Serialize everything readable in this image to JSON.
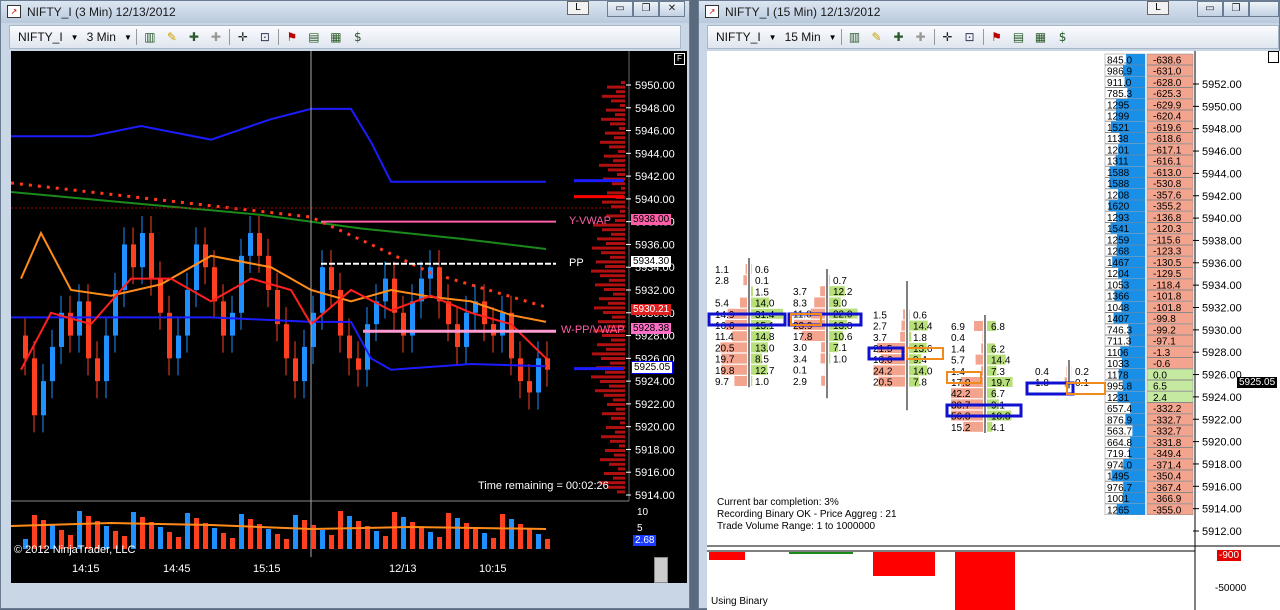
{
  "left_window": {
    "title": "NIFTY_I (3 Min)  12/13/2012",
    "toolbar": {
      "instrument": "NIFTY_I",
      "period": "3 Min"
    },
    "buttons": {
      "link": "L",
      "minimize": "▭",
      "restore": "❐",
      "close": "✕"
    },
    "chart": {
      "f_button": "F",
      "price_ticks": [
        "5950.00",
        "5948.00",
        "5946.00",
        "5944.00",
        "5942.00",
        "5940.00",
        "5938.00",
        "5936.00",
        "5934.00",
        "5932.00",
        "5930.00",
        "5928.00",
        "5926.00",
        "5924.00",
        "5922.00",
        "5920.00",
        "5918.00",
        "5916.00",
        "5914.00"
      ],
      "labels": {
        "y_vwap": "Y-VWAP",
        "pp": "PP",
        "wapp_vwap": "W-PP/VWAP"
      },
      "price_badges": {
        "y_vwap": "5938.00",
        "pp": "5934.30",
        "red": "5930.21",
        "pink": "5928.38",
        "current": "5925.05"
      },
      "time_remaining": "Time remaining = 00:02:26",
      "copyright": "© 2012 NinjaTrader, LLC",
      "volume_ticks": [
        "10",
        "5"
      ],
      "volume_badge": "2.68",
      "x_ticks": [
        "14:15",
        "14:45",
        "15:15",
        "12/13",
        "10:15"
      ]
    }
  },
  "right_window": {
    "title": "NIFTY_I (15 Min)  12/13/2012",
    "toolbar": {
      "instrument": "NIFTY_I",
      "period": "15 Min"
    },
    "buttons": {
      "link": "L",
      "minimize": "▭",
      "restore": "❐"
    },
    "chart": {
      "price_ticks": [
        "5952.00",
        "5950.00",
        "5948.00",
        "5946.00",
        "5944.00",
        "5942.00",
        "5940.00",
        "5938.00",
        "5936.00",
        "5934.00",
        "5932.00",
        "5930.00",
        "5928.00",
        "5926.00",
        "5924.00",
        "5922.00",
        "5920.00",
        "5918.00",
        "5916.00",
        "5914.00",
        "5912.00"
      ],
      "current_price": "5925.05",
      "status_lines": [
        "Current bar completion: 3%",
        "Recording Binary OK - Price Aggreg : 21",
        "Trade Volume Range: 1 to 1000000"
      ],
      "using_binary": "Using Binary",
      "copyright": "© 2012 NinjaTrader, LLC",
      "lower_ticks": [
        "-900",
        "-50000"
      ],
      "ladder_volume": [
        "845.0",
        "986.9",
        "911.0",
        "785.3",
        "1295",
        "1299",
        "1521",
        "1138",
        "1201",
        "1311",
        "1588",
        "1588",
        "1208",
        "1620",
        "1293",
        "1541",
        "1259",
        "1268",
        "1467",
        "1204",
        "1053",
        "1366",
        "1048",
        "1407",
        "746.3",
        "711.3",
        "1106",
        "1033",
        "1178",
        "995.8",
        "1231",
        "657.4",
        "876.9",
        "563.7",
        "664.8",
        "719.1",
        "974.0",
        "1495",
        "976.7",
        "1001",
        "1265"
      ],
      "ladder_delta": [
        "-638.6",
        "-631.0",
        "-628.0",
        "-625.3",
        "-629.9",
        "-620.4",
        "-619.6",
        "-618.6",
        "-617.1",
        "-616.1",
        "-613.0",
        "-530.8",
        "-357.6",
        "-355.2",
        "-136.8",
        "-120.3",
        "-115.6",
        "-123.3",
        "-130.5",
        "-129.5",
        "-118.4",
        "-101.8",
        "-101.8",
        "-99.8",
        "-99.2",
        "-97.1",
        "-1.3",
        "-0.6",
        "0.0",
        "6.5",
        "2.4",
        "-332.2",
        "-332.7",
        "-332.7",
        "-331.8",
        "-349.4",
        "-371.4",
        "-350.4",
        "-367.4",
        "-366.9",
        "-355.0"
      ],
      "footprint": [
        {
          "sell": [
            "1.1",
            "2.8",
            "",
            "5.4",
            "14.9",
            "16.6",
            "11.4",
            "20.5",
            "19.7",
            "19.8",
            "9.7"
          ],
          "buy": [
            "0.6",
            "0.1",
            "1.5",
            "14.0",
            "31.4",
            "15.1",
            "14.8",
            "13.0",
            "8.5",
            "12.7",
            "1.0"
          ]
        },
        {
          "sell": [
            "",
            "3.7",
            "8.3",
            "11.0",
            "23.9",
            "17.8",
            "3.0",
            "3.4",
            "0.1",
            "2.9",
            ""
          ],
          "buy": [
            "0.7",
            "12.2",
            "9.0",
            "22.0",
            "13.8",
            "10.6",
            "7.1",
            "1.0",
            "",
            "",
            ""
          ]
        },
        {
          "sell": [
            "",
            "",
            "1.5",
            "2.7",
            "3.7",
            "21.5",
            "18.6",
            "24.2",
            "20.5",
            "",
            ""
          ],
          "buy": [
            "",
            "",
            "0.6",
            "14.4",
            "1.8",
            "13.6",
            "9.4",
            "14.0",
            "7.8",
            "",
            ""
          ]
        },
        {
          "sell": [
            "6.9",
            "0.4",
            "1.4",
            "5.7",
            "1.4",
            "17.0",
            "42.2",
            "30.7",
            "56.8",
            "15.2"
          ],
          "buy": [
            "6.8",
            "",
            "6.2",
            "14.4",
            "7.3",
            "19.7",
            "6.7",
            "9.1",
            "18.8",
            "4.1"
          ]
        },
        {
          "sell": [
            "0.4",
            "1.8"
          ],
          "buy": [
            "0.2",
            "0.1"
          ]
        }
      ]
    }
  }
}
